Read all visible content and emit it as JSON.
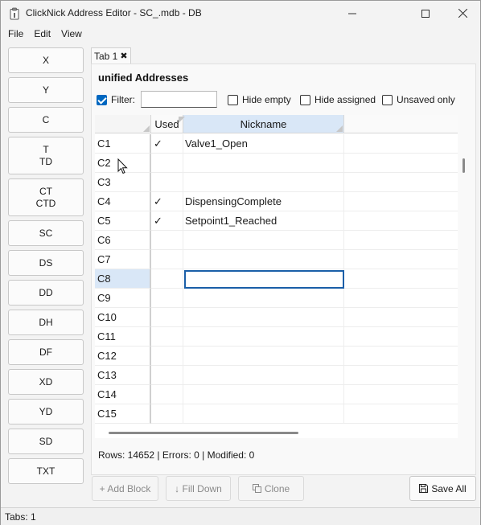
{
  "window": {
    "title": "ClickNick Address Editor - SC_.mdb - DB",
    "app_icon": "clipboard-icon",
    "controls": [
      "minimize-icon",
      "maximize-icon",
      "close-icon"
    ]
  },
  "menu": [
    "File",
    "Edit",
    "View"
  ],
  "sidebar": [
    {
      "line1": "X",
      "line2": ""
    },
    {
      "line1": "Y",
      "line2": ""
    },
    {
      "line1": "C",
      "line2": ""
    },
    {
      "line1": "T",
      "line2": "TD"
    },
    {
      "line1": "CT",
      "line2": "CTD"
    },
    {
      "line1": "SC",
      "line2": ""
    },
    {
      "line1": "DS",
      "line2": ""
    },
    {
      "line1": "DD",
      "line2": ""
    },
    {
      "line1": "DH",
      "line2": ""
    },
    {
      "line1": "DF",
      "line2": ""
    },
    {
      "line1": "XD",
      "line2": ""
    },
    {
      "line1": "YD",
      "line2": ""
    },
    {
      "line1": "SD",
      "line2": ""
    },
    {
      "line1": "TXT",
      "line2": ""
    }
  ],
  "tabs": [
    {
      "label": "Tab 1",
      "close": "✖"
    }
  ],
  "panel": {
    "title": "unified Addresses",
    "filter_label": "Filter:",
    "filter_value": "",
    "filter_checked": true,
    "options": [
      {
        "label": "Hide empty",
        "checked": false
      },
      {
        "label": "Hide assigned",
        "checked": false
      },
      {
        "label": "Unsaved only",
        "checked": false
      }
    ]
  },
  "table": {
    "columns": {
      "address": "",
      "used": "Used",
      "nickname": "Nickname"
    },
    "selected_row": "C8",
    "rows": [
      {
        "address": "C1",
        "used": "✓",
        "nickname": "Valve1_Open"
      },
      {
        "address": "C2",
        "used": "",
        "nickname": ""
      },
      {
        "address": "C3",
        "used": "",
        "nickname": ""
      },
      {
        "address": "C4",
        "used": "✓",
        "nickname": "DispensingComplete"
      },
      {
        "address": "C5",
        "used": "✓",
        "nickname": "Setpoint1_Reached"
      },
      {
        "address": "C6",
        "used": "",
        "nickname": ""
      },
      {
        "address": "C7",
        "used": "",
        "nickname": ""
      },
      {
        "address": "C8",
        "used": "",
        "nickname": ""
      },
      {
        "address": "C9",
        "used": "",
        "nickname": ""
      },
      {
        "address": "C10",
        "used": "",
        "nickname": ""
      },
      {
        "address": "C11",
        "used": "",
        "nickname": ""
      },
      {
        "address": "C12",
        "used": "",
        "nickname": ""
      },
      {
        "address": "C13",
        "used": "",
        "nickname": ""
      },
      {
        "address": "C14",
        "used": "",
        "nickname": ""
      },
      {
        "address": "C15",
        "used": "",
        "nickname": ""
      }
    ]
  },
  "status": "Rows: 14652 | Errors: 0 | Modified: 0",
  "actions": {
    "add_block": "+ Add Block",
    "fill_down": "↓ Fill Down",
    "clone": "Clone",
    "clone_icon": "copy-icon",
    "save_all": "Save All",
    "save_icon": "floppy-disk-icon"
  },
  "statusbar": "Tabs: 1"
}
